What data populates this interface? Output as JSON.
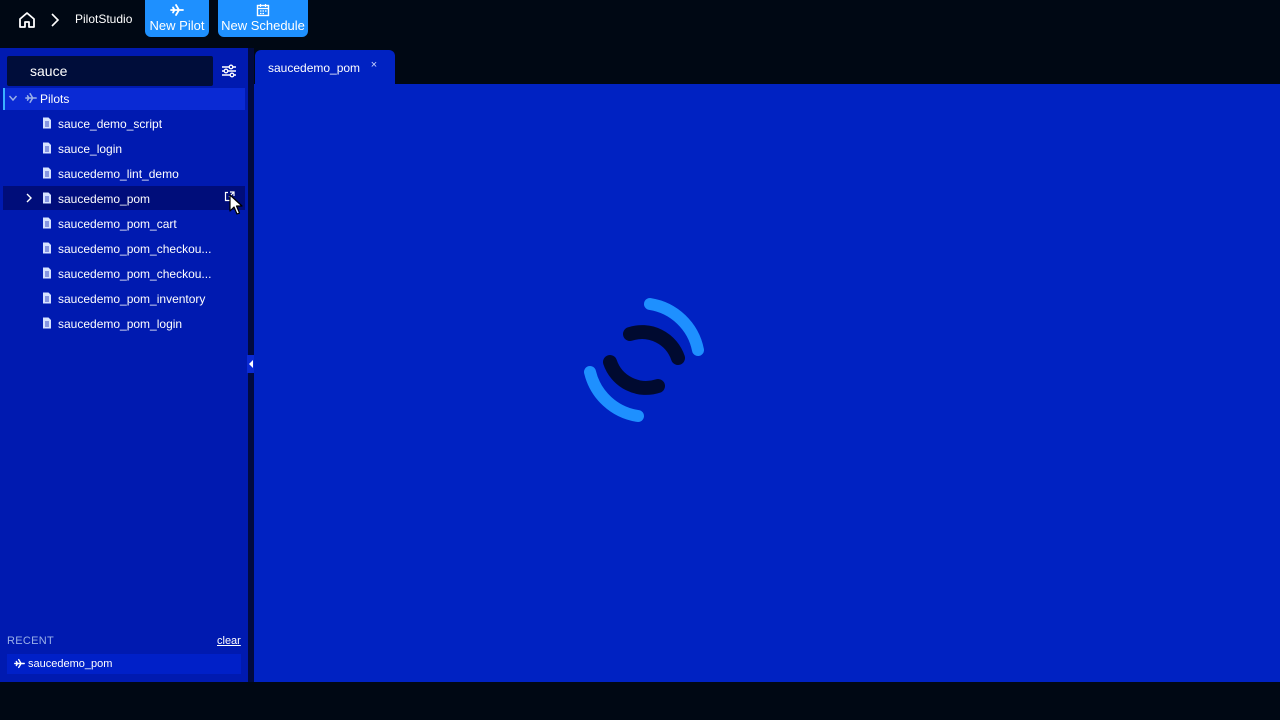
{
  "header": {
    "breadcrumb_app": "PilotStudio",
    "new_pilot_label": "New Pilot",
    "new_schedule_label": "New Schedule"
  },
  "sidebar": {
    "search_value": "sauce",
    "tree_root_label": "Pilots",
    "items": [
      {
        "label": "sauce_demo_script"
      },
      {
        "label": "sauce_login"
      },
      {
        "label": "saucedemo_lint_demo"
      },
      {
        "label": "saucedemo_pom",
        "active": true
      },
      {
        "label": "saucedemo_pom_cart"
      },
      {
        "label": "saucedemo_pom_checkou..."
      },
      {
        "label": "saucedemo_pom_checkou..."
      },
      {
        "label": "saucedemo_pom_inventory"
      },
      {
        "label": "saucedemo_pom_login"
      }
    ],
    "recent": {
      "label": "RECENT",
      "clear_label": "clear",
      "items": [
        {
          "label": "saucedemo_pom"
        }
      ]
    }
  },
  "tabs": [
    {
      "label": "saucedemo_pom",
      "close_glyph": "×"
    }
  ],
  "content": {
    "state": "loading"
  },
  "colors": {
    "accent": "#1e90ff",
    "sidebar_bg": "#001ab0",
    "content_bg": "#0022c2",
    "chrome_bg": "#000814"
  }
}
